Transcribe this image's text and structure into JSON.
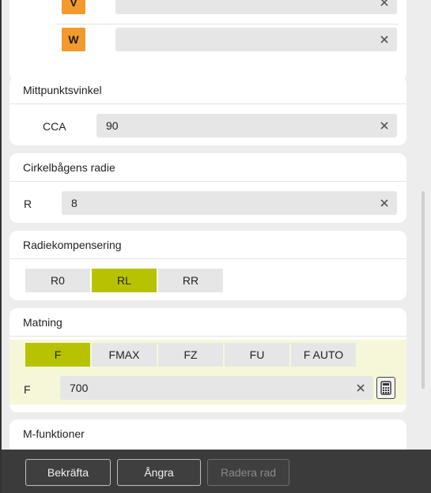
{
  "top_card": {
    "letters": [
      "V",
      "W"
    ],
    "w_value": ""
  },
  "center_angle": {
    "title": "Mittpunktsvinkel",
    "label": "CCA",
    "value": "90"
  },
  "arc_radius": {
    "title": "Cirkelbågens radie",
    "label": "R",
    "value": "8"
  },
  "radius_comp": {
    "title": "Radiekompensering",
    "options": [
      "R0",
      "RL",
      "RR"
    ],
    "selected": "RL"
  },
  "feed": {
    "title": "Matning",
    "options": [
      "F",
      "FMAX",
      "FZ",
      "FU",
      "F AUTO"
    ],
    "selected": "F",
    "label": "F",
    "value": "700"
  },
  "m_functions": {
    "title": "M-funktioner"
  },
  "footer": {
    "confirm_label": "Bekräfta",
    "undo_label": "Ångra",
    "delete_row_label": "Radera rad"
  },
  "colors": {
    "accent_green": "#b7c300",
    "badge_orange": "#f39a2e",
    "footer_bg": "#3b3b3b"
  }
}
